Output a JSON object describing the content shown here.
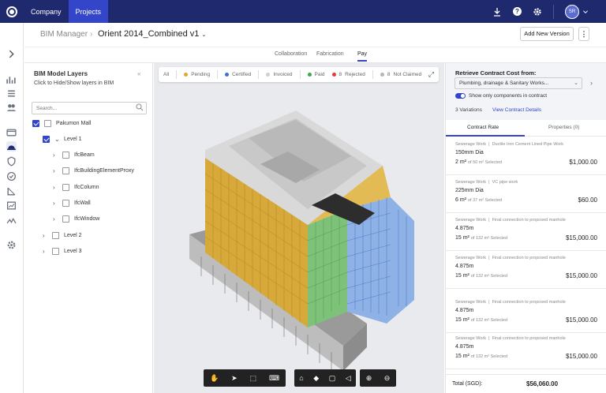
{
  "nav": {
    "company": "Company",
    "projects": "Projects",
    "avatar_initials": "SR"
  },
  "header": {
    "breadcrumb_root": "BIM Manager",
    "project": "Orient 2014_Combined v1",
    "add_version": "Add New Version"
  },
  "tabs": [
    "Collaboration",
    "Fabrication",
    "Pay"
  ],
  "layers": {
    "title": "BIM Model Layers",
    "subtitle": "Click to Hide/Show layers in BIM",
    "search_placeholder": "Search...",
    "tree": [
      "Pakumon Mall",
      "Level 1",
      "IfcBeam",
      "IfcBuildingElementProxy",
      "IfcColumn",
      "IfcWall",
      "IfcWindow",
      "Level 2",
      "Level 3"
    ]
  },
  "filters": {
    "all": "All",
    "pending": "Pending",
    "certified": "Certified",
    "invoiced": "Invoiced",
    "paid": "Paid",
    "rejected_count": "8",
    "rejected": "Rejected",
    "not_claimed_count": "8",
    "not_claimed": "Not Claimed",
    "colors": {
      "pending": "#e0a92e",
      "certified": "#3a72d8",
      "invoiced": "#cfcfcf",
      "paid": "#3aa84b",
      "rejected": "#e03a3a",
      "not_claimed": "#b5b5b5"
    }
  },
  "contract": {
    "title": "Retrieve Contract Cost from:",
    "selected": "Plumbing, drainage & Sanitary Works...",
    "toggle_label": "Show only components in contract",
    "variations": "3 Variations",
    "view_details": "View Contract Details",
    "tab_rate": "Contract Rate",
    "tab_properties": "Properties (0)",
    "items": [
      {
        "category": "Sewerage Work",
        "subcategory": "Ductile Iron Cement Lined Pipe Work",
        "name": "150mm Dia",
        "qty": "2 m²",
        "of": "of 50 m² Selected",
        "amount": "$1,000.00"
      },
      {
        "category": "Sewerage Work",
        "subcategory": "VC pipe work",
        "name": "225mm Dia",
        "qty": "6 m²",
        "of": "of 37 m² Selected",
        "amount": "$60.00"
      },
      {
        "category": "Sewerage Work",
        "subcategory": "Final connection to proposed manhole",
        "name": "4.875m",
        "qty": "15 m²",
        "of": "of 132 m² Selected",
        "amount": "$15,000.00"
      },
      {
        "category": "Sewerage Work",
        "subcategory": "Final connection to proposed manhole",
        "name": "4.875m",
        "qty": "15 m²",
        "of": "of 132 m² Selected",
        "amount": "$15,000.00"
      },
      {
        "category": "Sewerage Work",
        "subcategory": "Final connection to proposed manhole",
        "name": "4.875m",
        "qty": "15 m²",
        "of": "of 132 m² Selected",
        "amount": "$15,000.00"
      },
      {
        "category": "Sewerage Work",
        "subcategory": "Final connection to proposed manhole",
        "name": "4.875m",
        "qty": "15 m²",
        "of": "of 132 m² Selected",
        "amount": "$15,000.00"
      }
    ],
    "total_label": "Total (SGD):",
    "total_value": "$56,060.00"
  }
}
